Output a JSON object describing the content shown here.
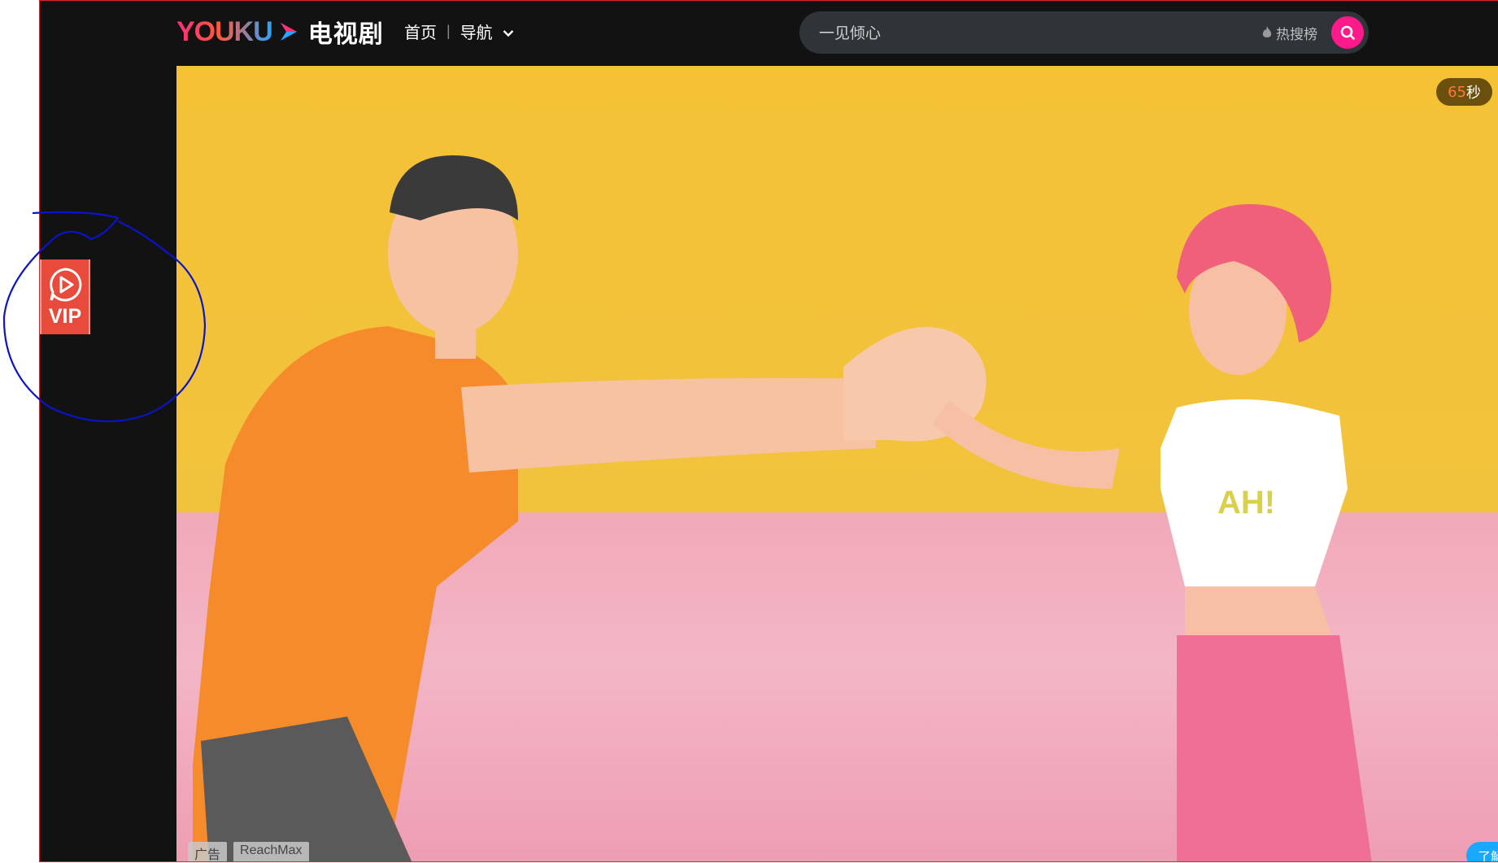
{
  "header": {
    "logo_text": "YOUKU",
    "channel": "电视剧",
    "nav": [
      {
        "label": "首页"
      },
      {
        "label": "导航"
      }
    ],
    "nav_separator": "|",
    "search": {
      "placeholder": "一见倾心",
      "hot_label": "热搜榜",
      "button_icon": "search-icon"
    }
  },
  "sidebar": {
    "vip_label": "VIP",
    "vip_icon": "play-chat-icon"
  },
  "ad": {
    "countdown_number": "65",
    "countdown_unit": "秒",
    "tags": [
      "广告",
      "ReachMax"
    ],
    "learn_more": "了解"
  },
  "colors": {
    "accent_pink": "#ff1a8c",
    "vip_red": "#e84a3b",
    "frame_border": "#e0242c",
    "annotation": "#0a14c8"
  }
}
